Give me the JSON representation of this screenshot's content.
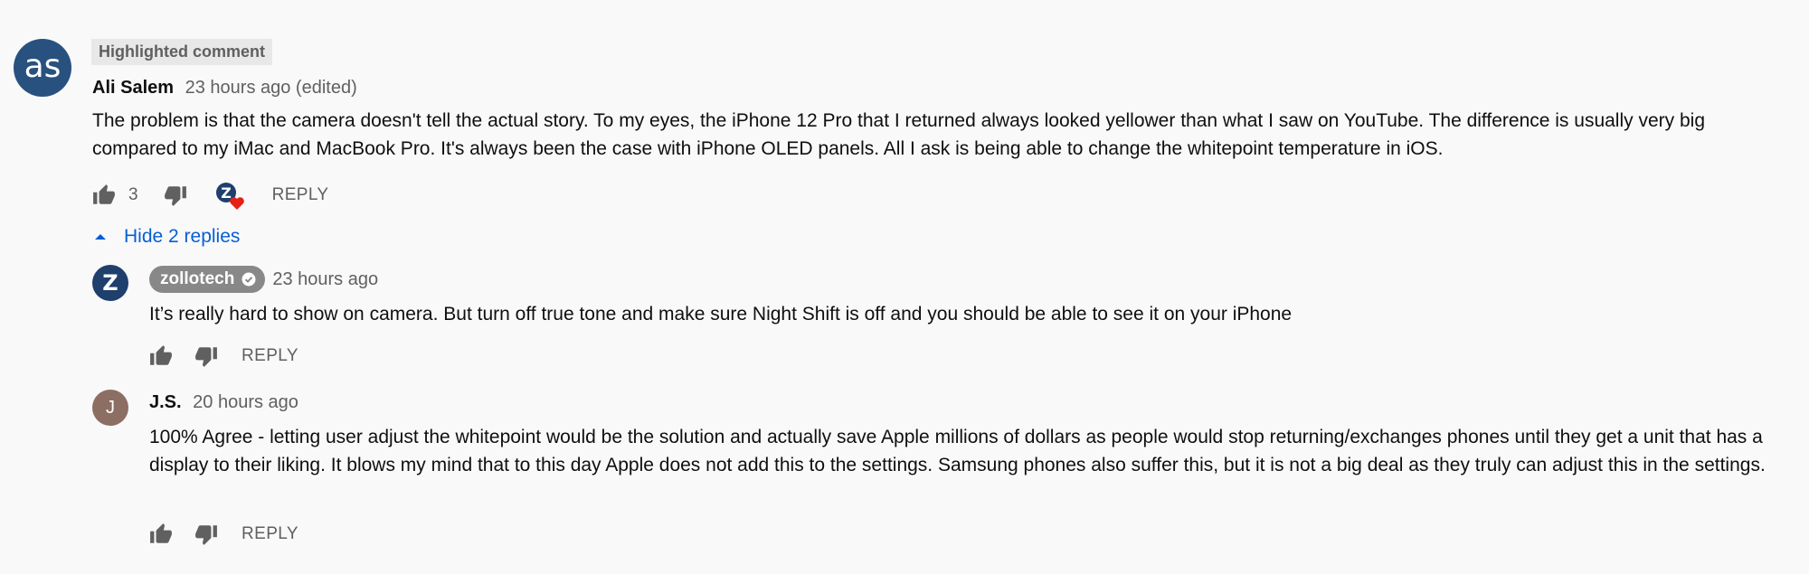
{
  "comment": {
    "avatar_glyph": "as",
    "badge": "Highlighted comment",
    "author": "Ali Salem",
    "time": "23 hours ago (edited)",
    "text": "The problem is that the camera doesn't tell the actual story. To my eyes, the iPhone 12 Pro that I returned always looked yellower than what I saw on YouTube. The difference is usually very big compared to my iMac and MacBook Pro. It's always been the case with iPhone OLED panels. All I ask is being able to change the whitepoint temperature in iOS.",
    "likes": "3",
    "reply_label": "REPLY"
  },
  "replies_toggle": {
    "label": "Hide 2 replies"
  },
  "replies": [
    {
      "author": "zollotech",
      "avatar_glyph": "Z",
      "time": "23 hours ago",
      "text": "It’s really hard to show on camera. But turn off true tone and make sure Night Shift is off and you should be able to see it on your iPhone",
      "reply_label": "REPLY"
    },
    {
      "author": "J.S.",
      "avatar_glyph": "J",
      "time": "20 hours ago",
      "text": "100% Agree - letting user adjust the whitepoint would be the solution and actually save Apple millions of dollars as people would stop returning/exchanges phones until they get a unit that has a display to their liking. It blows my mind that to this day Apple does not add this to the settings. Samsung phones also suffer this, but it is not a big deal as they truly can adjust this in the settings.",
      "reply_label": "REPLY"
    }
  ],
  "colors": {
    "link_blue": "#065fd4",
    "heart_red": "#e62117",
    "creator_chip": "#888888",
    "avatar_js": "#8d6e63",
    "avatar_as": "#28517f"
  },
  "icons": [
    "thumbs-up-icon",
    "thumbs-down-icon",
    "creator-heart-icon",
    "caret-up-icon",
    "verified-check-icon"
  ]
}
